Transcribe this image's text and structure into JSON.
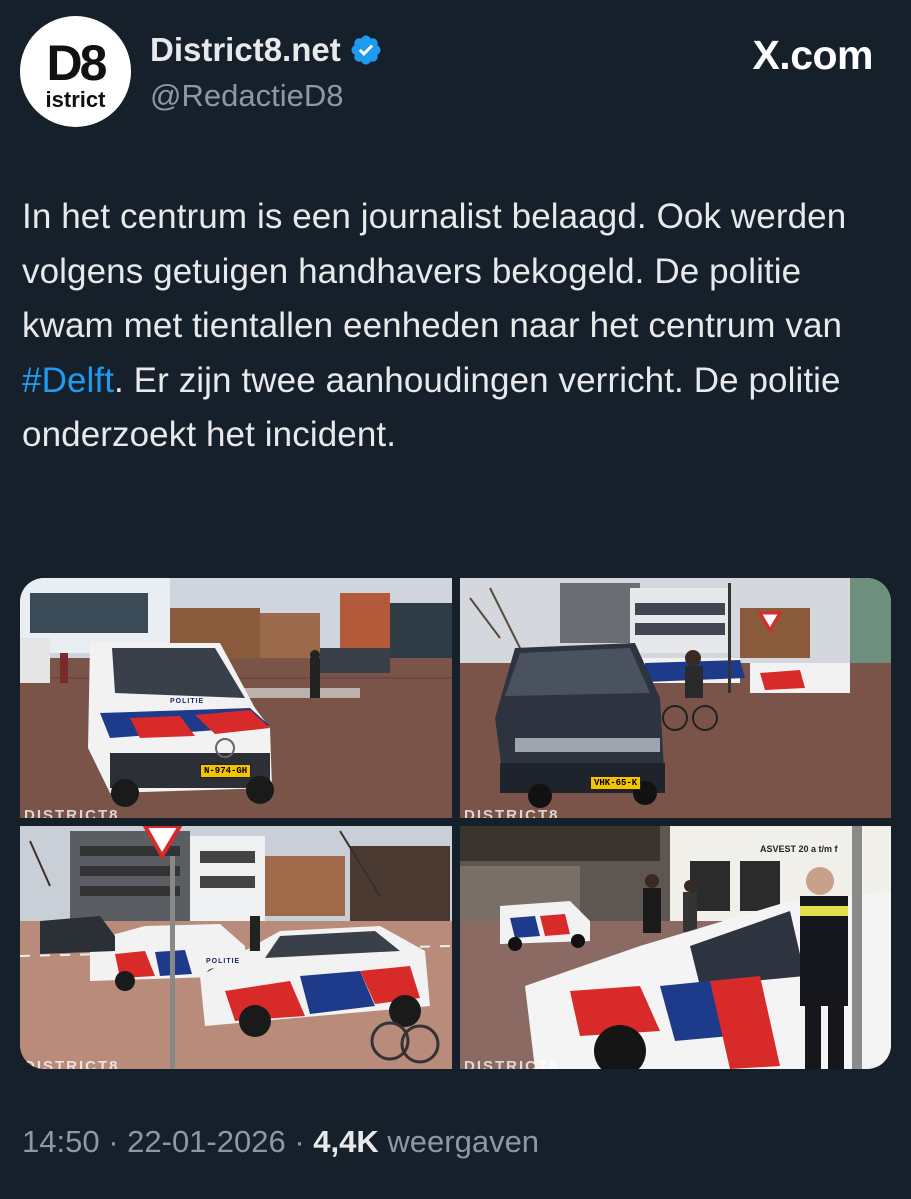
{
  "author": {
    "avatar_line1": "D8",
    "avatar_line2": "istrict",
    "display_name": "District8.net",
    "handle": "@RedactieD8",
    "verified_color": "#1d9bf0"
  },
  "source": {
    "label": "X.com"
  },
  "tweet": {
    "text_parts": [
      "In het centrum is een journalist belaagd. Ook werden volgens getuigen handhavers bekogeld. De politie kwam met tientallen eenheden naar het centrum van ",
      "#Delft",
      ". Er zijn twee aanhoudingen verricht. De politie onderzoekt het incident."
    ]
  },
  "media": {
    "watermark": "DISTRICT8",
    "photo1": {
      "plate": "N-974-GH",
      "car_label": "POLITIE"
    },
    "photo2": {
      "plate": "VHK-65-K"
    },
    "photo3": {
      "car_label": "POLITIE"
    },
    "photo4": {
      "sign": "ASVEST 20 a t/m f"
    }
  },
  "meta": {
    "time": "14:50",
    "separator": " · ",
    "date": "22-01-2026",
    "views_count": "4,4K",
    "views_label": "weergaven"
  },
  "colors": {
    "background": "#15202b",
    "text": "#e7e9ea",
    "secondary": "#8b98a5",
    "link": "#1d9bf0"
  }
}
